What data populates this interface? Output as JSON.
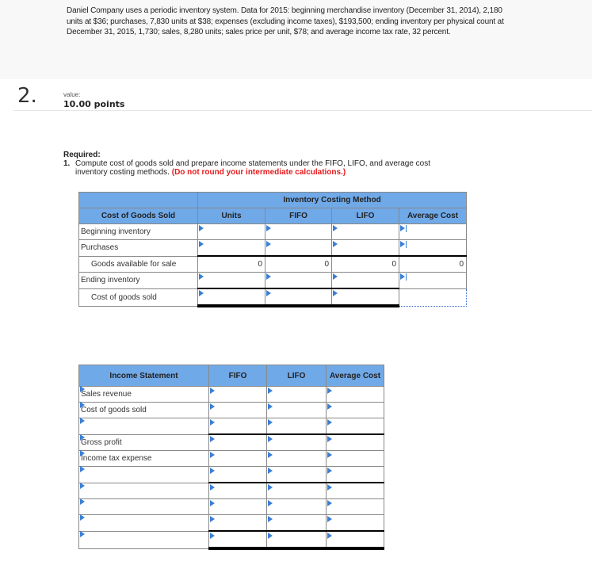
{
  "intro": {
    "text": "Daniel Company uses a periodic inventory system. Data for 2015: beginning merchandise inventory (December 31, 2014), 2,180 units at $36; purchases, 7,830 units at $38; expenses (excluding income taxes), $193,500; ending inventory per physical count at December 31, 2015, 1,730; sales, 8,280 units; sales price per unit, $78; and average income tax rate, 32 percent."
  },
  "question": {
    "number": "2.",
    "value_label": "value:",
    "points": "10.00 points"
  },
  "required": {
    "heading": "Required:",
    "item_number": "1.",
    "text_line1": "Compute cost of goods sold and prepare income statements under the FIFO, LIFO, and average cost",
    "text_line2": "inventory costing methods.",
    "warning": "(Do not round your intermediate calculations.)"
  },
  "cogs_table": {
    "group_header": "Inventory Costing Method",
    "headers": [
      "Cost of Goods Sold",
      "Units",
      "FIFO",
      "LIFO",
      "Average Cost"
    ],
    "rows": [
      {
        "label": "Beginning inventory",
        "values": [
          "",
          "",
          "",
          ""
        ]
      },
      {
        "label": "Purchases",
        "values": [
          "",
          "",
          "",
          ""
        ]
      },
      {
        "label": "Goods available for sale",
        "values": [
          "0",
          "0",
          "0",
          "0"
        ]
      },
      {
        "label": "Ending inventory",
        "values": [
          "",
          "",
          "",
          ""
        ]
      },
      {
        "label": "Cost of goods sold",
        "values": [
          "",
          "",
          "",
          ""
        ]
      }
    ]
  },
  "income_table": {
    "headers": [
      "Income Statement",
      "FIFO",
      "LIFO",
      "Average Cost"
    ],
    "rows": [
      {
        "label": "Sales revenue",
        "values": [
          "",
          "",
          ""
        ]
      },
      {
        "label": "Cost of goods sold",
        "values": [
          "",
          "",
          ""
        ]
      },
      {
        "label": "",
        "values": [
          "",
          "",
          ""
        ]
      },
      {
        "label": "Gross profit",
        "values": [
          "",
          "",
          ""
        ]
      },
      {
        "label": "Income tax expense",
        "values": [
          "",
          "",
          ""
        ]
      },
      {
        "label": "",
        "values": [
          "",
          "",
          ""
        ]
      },
      {
        "label": "",
        "values": [
          "",
          "",
          ""
        ]
      },
      {
        "label": "",
        "values": [
          "",
          "",
          ""
        ]
      },
      {
        "label": "",
        "values": [
          "",
          "",
          ""
        ]
      },
      {
        "label": "",
        "values": [
          "",
          "",
          ""
        ]
      }
    ]
  },
  "colors": {
    "header_blue": "#70a9e8",
    "marker_blue": "#3b7fd4",
    "warning_red": "#e8191b"
  }
}
